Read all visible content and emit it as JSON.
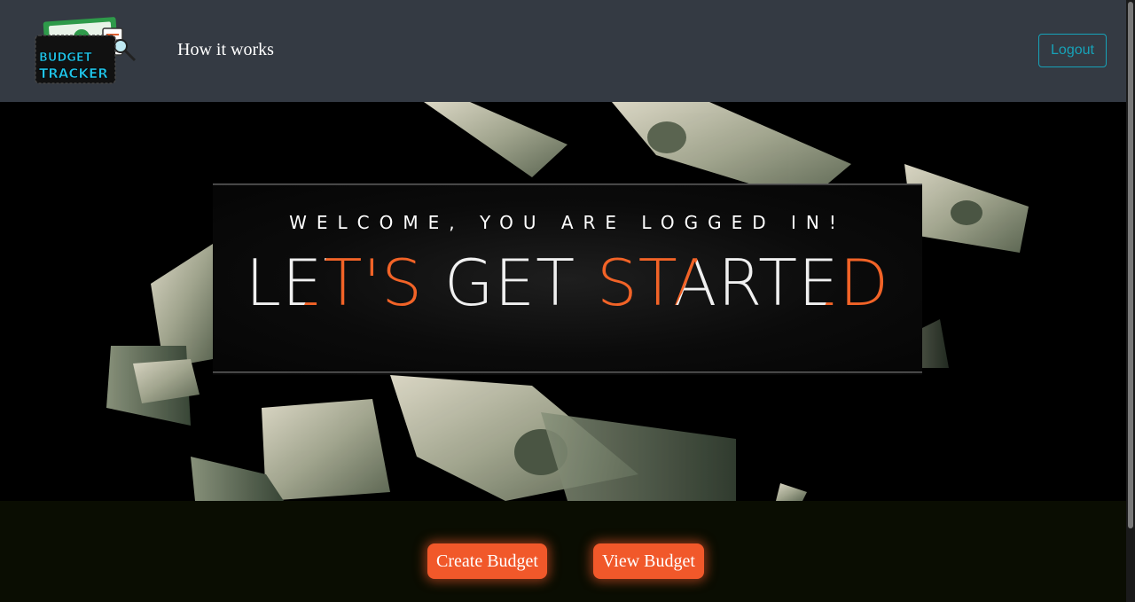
{
  "navbar": {
    "logo": {
      "line1": "BUDGET",
      "line2": "TRACKER",
      "icon": "budget-tracker-logo"
    },
    "links": [
      {
        "label": "How it works"
      }
    ],
    "logout_label": "Logout"
  },
  "hero": {
    "welcome": "WELCOME, YOU ARE LOGGED IN!",
    "headline": "LET'S GET STARTED",
    "background": "falling-money-bills"
  },
  "actions": {
    "create_label": "Create Budget",
    "view_label": "View Budget"
  },
  "colors": {
    "navbar_bg": "#343a43",
    "accent_orange": "#f1582a",
    "logout_teal": "#17a2b8",
    "page_bg": "#0a0d02"
  }
}
